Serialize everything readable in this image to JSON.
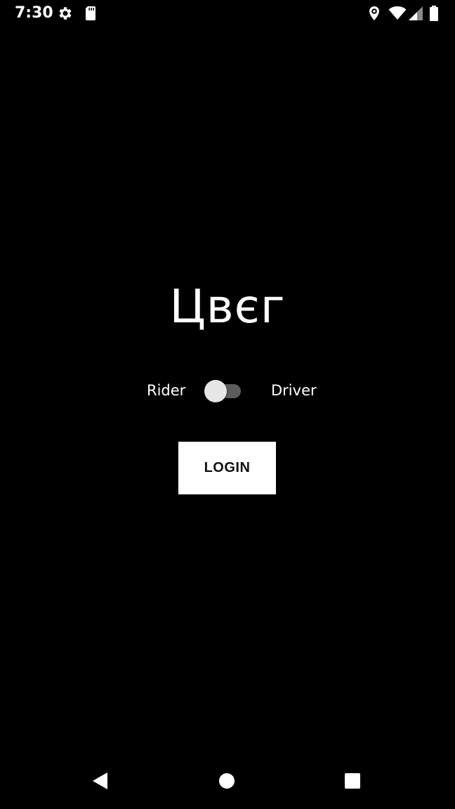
{
  "status_bar": {
    "time": "7:30",
    "icons": [
      "settings-icon",
      "sd-card-icon",
      "location-icon",
      "wifi-icon",
      "signal-icon",
      "battery-icon"
    ]
  },
  "app": {
    "logo_text": "Цвєг"
  },
  "mode_switch": {
    "left_label": "Rider",
    "right_label": "Driver",
    "checked": false
  },
  "login": {
    "label": "LOGIN"
  },
  "nav_bar": {
    "icons": [
      "back-icon",
      "home-icon",
      "recents-icon"
    ]
  },
  "colors": {
    "background": "#000000",
    "text": "#ffffff",
    "button_bg": "#ffffff",
    "button_text": "#111111",
    "switch_track": "#5c5c5c",
    "switch_thumb": "#e6e6e6"
  }
}
